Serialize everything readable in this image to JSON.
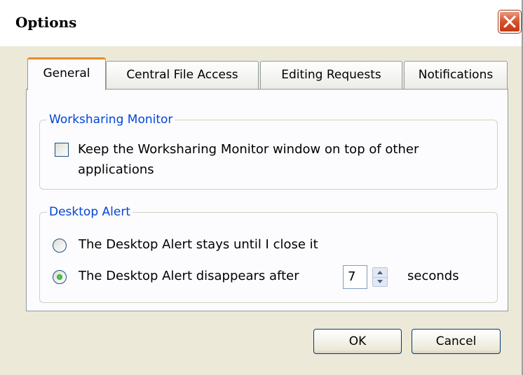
{
  "window": {
    "title": "Options",
    "close_icon": "close-icon",
    "accent_close": "#d6532d"
  },
  "tabs": [
    {
      "label": "General",
      "active": true
    },
    {
      "label": "Central File Access",
      "active": false
    },
    {
      "label": "Editing Requests",
      "active": false
    },
    {
      "label": "Notifications",
      "active": false
    }
  ],
  "worksharing_monitor": {
    "legend": "Worksharing Monitor",
    "keep_on_top": {
      "label_line1": "Keep the Worksharing Monitor window on top of other",
      "label_line2": "applications",
      "checked": false
    }
  },
  "desktop_alert": {
    "legend": "Desktop Alert",
    "option_stays": {
      "label": "The Desktop Alert stays until I close it",
      "selected": false
    },
    "option_disappears": {
      "label": "The Desktop Alert disappears after",
      "selected": true
    },
    "seconds_value": "7",
    "seconds_label": "seconds"
  },
  "buttons": {
    "ok": "OK",
    "cancel": "Cancel"
  },
  "colors": {
    "legend_text": "#0046d5",
    "active_tab_accent": "#e68b2c",
    "dialog_background": "#ece9d8"
  }
}
